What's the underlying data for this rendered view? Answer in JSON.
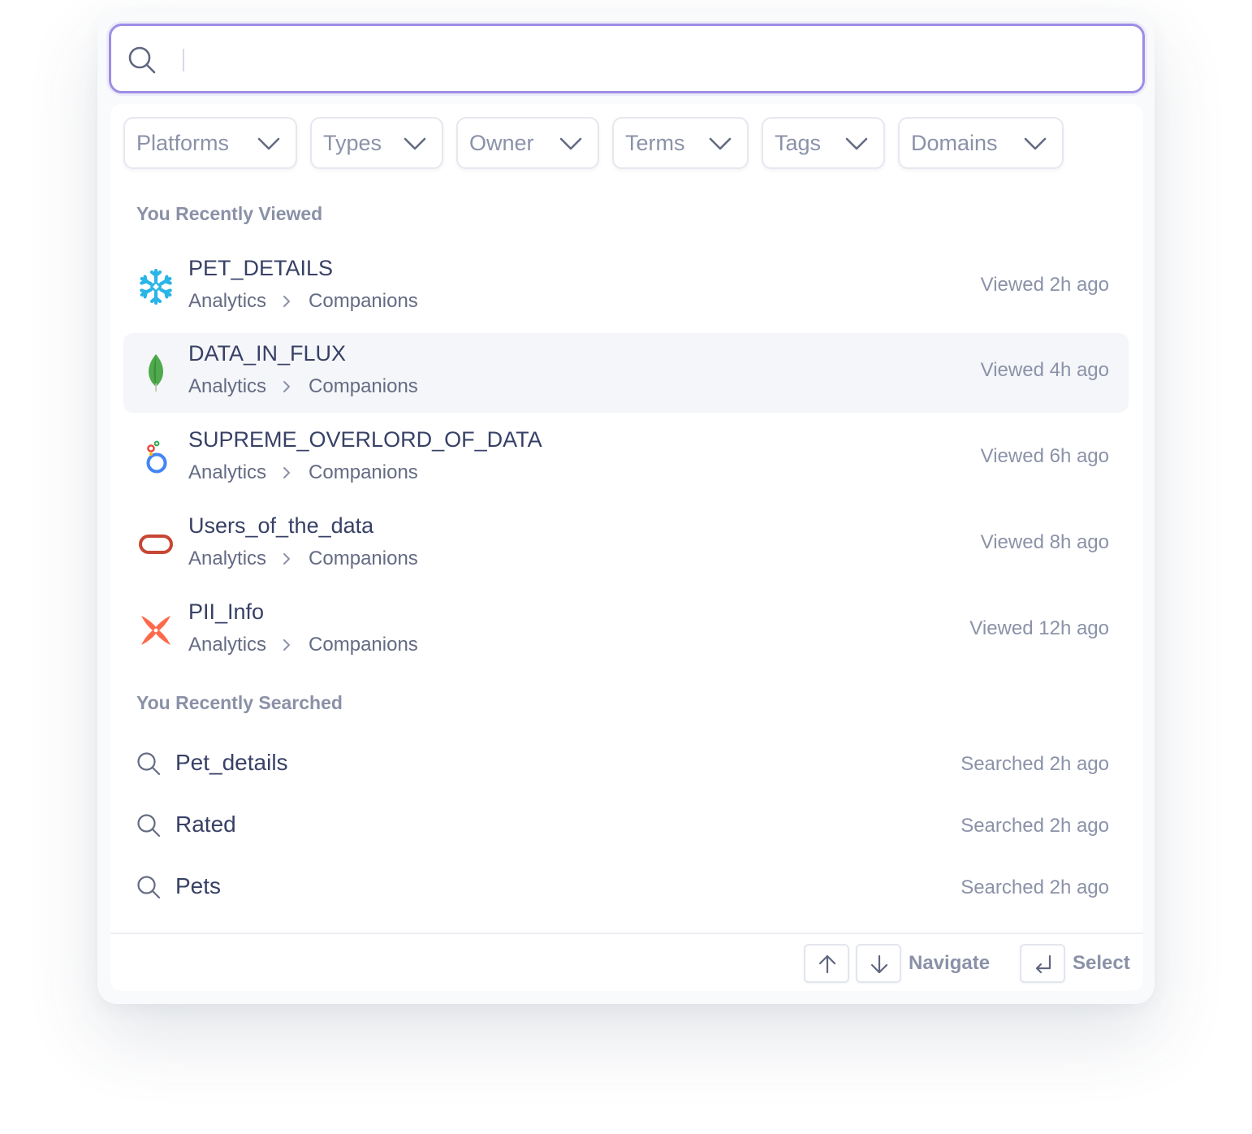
{
  "search": {
    "placeholder": "",
    "value": ""
  },
  "filters": [
    {
      "label": "Platforms"
    },
    {
      "label": "Types"
    },
    {
      "label": "Owner"
    },
    {
      "label": "Terms"
    },
    {
      "label": "Tags"
    },
    {
      "label": "Domains"
    }
  ],
  "recently_viewed": {
    "title": "You Recently Viewed",
    "items": [
      {
        "name": "PET_DETAILS",
        "path": [
          "Analytics",
          "Companions"
        ],
        "time": "Viewed 2h ago",
        "platform_icon": "snowflake-icon"
      },
      {
        "name": "DATA_IN_FLUX",
        "path": [
          "Analytics",
          "Companions"
        ],
        "time": "Viewed 4h ago",
        "platform_icon": "mongodb-leaf-icon"
      },
      {
        "name": "SUPREME_OVERLORD_OF_DATA",
        "path": [
          "Analytics",
          "Companions"
        ],
        "time": "Viewed 6h ago",
        "platform_icon": "looker-icon"
      },
      {
        "name": "Users_of_the_data",
        "path": [
          "Analytics",
          "Companions"
        ],
        "time": "Viewed 8h ago",
        "platform_icon": "oracle-icon"
      },
      {
        "name": "PII_Info",
        "path": [
          "Analytics",
          "Companions"
        ],
        "time": "Viewed 12h ago",
        "platform_icon": "dbt-icon"
      }
    ]
  },
  "recently_searched": {
    "title": "You Recently Searched",
    "items": [
      {
        "query": "Pet_details",
        "time": "Searched 2h ago"
      },
      {
        "query": "Rated",
        "time": "Searched 2h ago"
      },
      {
        "query": "Pets",
        "time": "Searched 2h ago"
      }
    ]
  },
  "footer": {
    "navigate_label": "Navigate",
    "select_label": "Select"
  },
  "colors": {
    "focus_border": "#9e8de6",
    "text_primary": "#374066",
    "text_muted": "#8b92a8",
    "highlight_row": "#f5f6f9"
  }
}
